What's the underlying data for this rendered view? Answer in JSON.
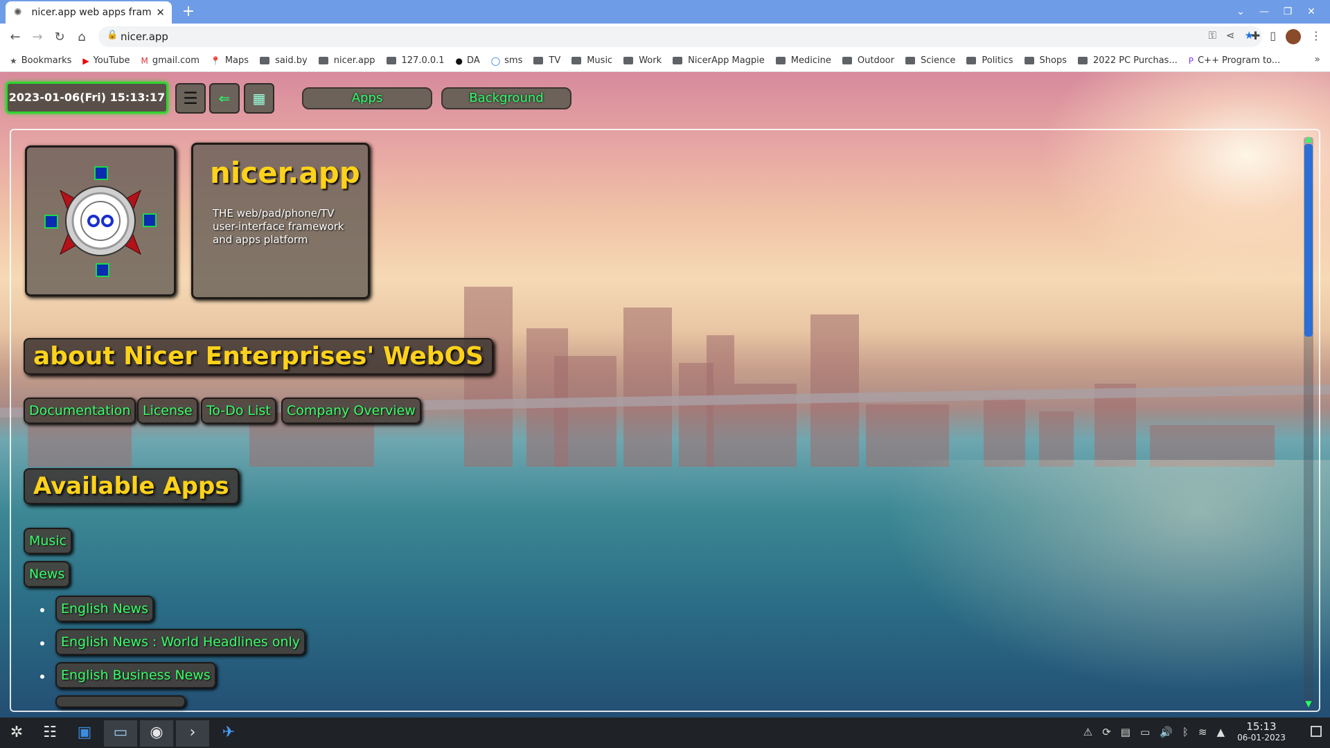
{
  "browser": {
    "tab_title": "nicer.app web apps framewor",
    "url": "nicer.app",
    "bookmarks": [
      "Bookmarks",
      "YouTube",
      "gmail.com",
      "Maps",
      "said.by",
      "nicer.app",
      "127.0.0.1",
      "DA",
      "sms",
      "TV",
      "Music",
      "Work",
      "NicerApp Magpie",
      "Medicine",
      "Outdoor",
      "Science",
      "Politics",
      "Shops",
      "2022 PC Purchas...",
      "C++ Program to..."
    ]
  },
  "page": {
    "datetime": "2023-01-06(Fri) 15:13:17",
    "menu_apps": "Apps",
    "menu_background": "Background",
    "brand": "nicer.app",
    "tagline": "THE web/pad/phone/TV user-interface framework and apps platform",
    "about_heading": "about Nicer Enterprises' WebOS",
    "about_links": [
      "Documentation",
      "License",
      "To-Do List",
      "Company Overview"
    ],
    "apps_heading": "Available Apps",
    "apps": [
      "Music",
      "News"
    ],
    "news_items": [
      "English News",
      "English News : World Headlines only",
      "English Business News"
    ]
  },
  "taskbar": {
    "time": "15:13",
    "date": "06-01-2023"
  },
  "colors": {
    "accent_green": "#2bff6a",
    "brand_yellow": "#ffd21a",
    "chrome_blue": "#6f9ce6"
  }
}
